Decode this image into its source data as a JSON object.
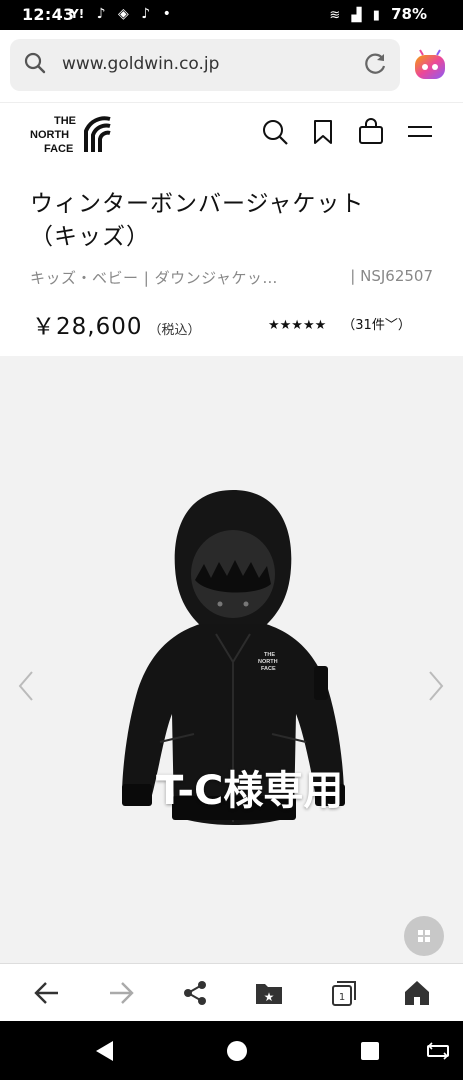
{
  "status_bar": {
    "time": "12:43",
    "notification_icons": [
      "Y!",
      "tiktok-icon",
      "cube-icon",
      "tiktok-icon",
      "•"
    ],
    "battery": "78%"
  },
  "browser": {
    "url": "www.goldwin.co.jp"
  },
  "site": {
    "logo_text": "THE NORTH FACE"
  },
  "product": {
    "title_line1": "ウィンターボンバージャケット",
    "title_line2": "（キッズ）",
    "category": "キッズ・ベビー | ダウンジャケッ…",
    "code": "| NSJ62507",
    "price": "￥28,600",
    "tax_label": "（税込）",
    "stars": "★★★★★",
    "stars_value": 5,
    "reviews": "（31件﹀）"
  },
  "gallery": {
    "overlay_text": "T-C様専用",
    "jacket_logo": "THE NORTH FACE"
  },
  "colors": {
    "brand_accent": "#8b5cf6",
    "text": "#111111",
    "muted": "#888888"
  }
}
